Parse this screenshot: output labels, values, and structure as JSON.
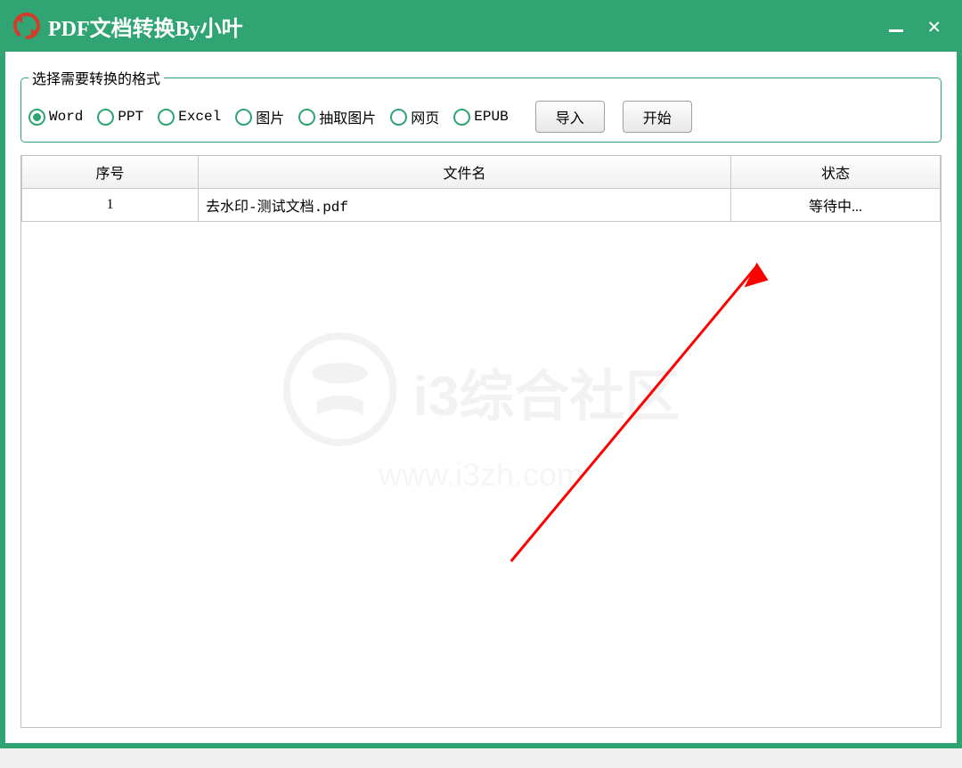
{
  "window": {
    "title": "PDF文档转换By小叶"
  },
  "formatGroup": {
    "legend": "选择需要转换的格式",
    "options": [
      {
        "label": "Word",
        "checked": true
      },
      {
        "label": "PPT",
        "checked": false
      },
      {
        "label": "Excel",
        "checked": false
      },
      {
        "label": "图片",
        "checked": false
      },
      {
        "label": "抽取图片",
        "checked": false
      },
      {
        "label": "网页",
        "checked": false
      },
      {
        "label": "EPUB",
        "checked": false
      }
    ],
    "buttons": {
      "import": "导入",
      "start": "开始"
    }
  },
  "table": {
    "headers": {
      "no": "序号",
      "name": "文件名",
      "status": "状态"
    },
    "rows": [
      {
        "no": "1",
        "name": "去水印-测试文档.pdf",
        "status": "等待中..."
      }
    ]
  },
  "watermark": {
    "text": "i3综合社区",
    "url": "www.i3zh.com"
  }
}
